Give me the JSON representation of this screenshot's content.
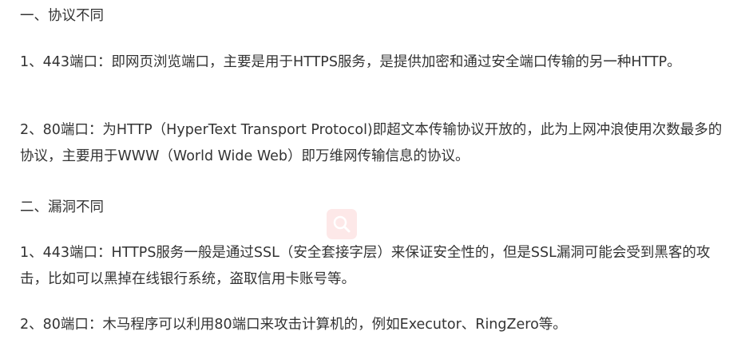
{
  "paragraphs": [
    "一、协议不同",
    "1、443端口：即网页浏览端口，主要是用于HTTPS服务，是提供加密和通过安全端口传输的另一种HTTP。",
    "2、80端口：为HTTP（HyperText Transport Protocol)即超文本传输协议开放的，此为上网冲浪使用次数最多的协议，主要用于WWW（World Wide Web）即万维网传输信息的协议。",
    "二、漏洞不同",
    "1、443端口：HTTPS服务一般是通过SSL（安全套接字层）来保证安全性的，但是SSL漏洞可能会受到黑客的攻击，比如可以黑掉在线银行系统，盗取信用卡账号等。",
    "2、80端口：木马程序可以利用80端口来攻击计算机的，例如Executor、RingZero等。"
  ],
  "icons": {
    "overlay": "search-icon"
  }
}
